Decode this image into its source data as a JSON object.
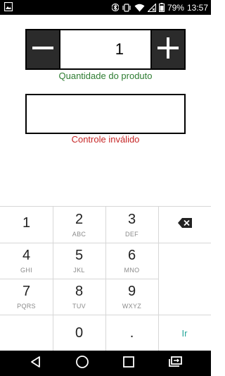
{
  "status_bar": {
    "battery_percent": "79%",
    "time": "13:57",
    "icons": [
      "image-notification-icon",
      "bluetooth-icon",
      "vibrate-icon",
      "wifi-icon",
      "no-sim-icon",
      "battery-icon"
    ]
  },
  "stepper": {
    "value": "1",
    "label": "Quantidade do produto",
    "decrement_icon": "minus-icon",
    "increment_icon": "plus-icon"
  },
  "control": {
    "value": "",
    "error_text": "Controle inválido"
  },
  "keypad": {
    "keys": [
      {
        "num": "1",
        "letters": ""
      },
      {
        "num": "2",
        "letters": "ABC"
      },
      {
        "num": "3",
        "letters": "DEF"
      },
      {
        "num": "4",
        "letters": "GHI"
      },
      {
        "num": "5",
        "letters": "JKL"
      },
      {
        "num": "6",
        "letters": "MNO"
      },
      {
        "num": "7",
        "letters": "PQRS"
      },
      {
        "num": "8",
        "letters": "TUV"
      },
      {
        "num": "9",
        "letters": "WXYZ"
      },
      {
        "num": "0",
        "letters": ""
      },
      {
        "num": ".",
        "letters": ""
      }
    ],
    "go_label": "Ir",
    "backspace_icon": "backspace-icon"
  },
  "colors": {
    "label_green": "#2e7d32",
    "error_red": "#c62828",
    "accent_teal": "#26a69a",
    "stepper_button": "#2b2b2b"
  }
}
